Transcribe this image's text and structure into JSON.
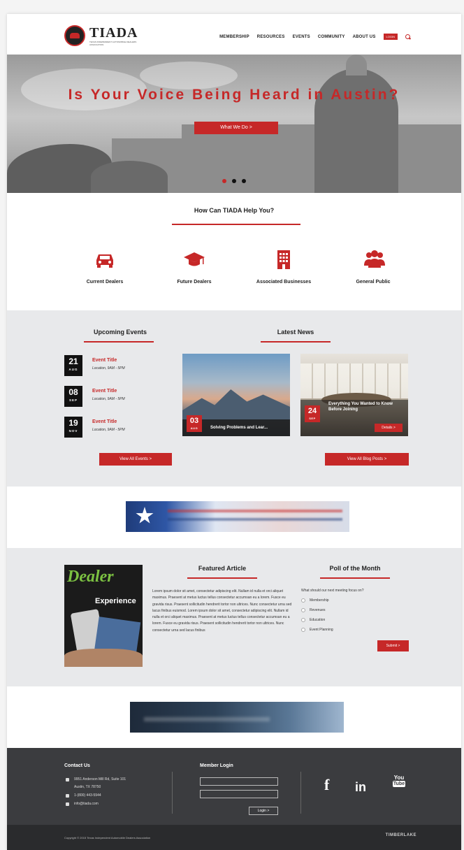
{
  "header": {
    "logo_name": "TIADA",
    "logo_tagline": "Texas Independent Automobile Dealers Association",
    "nav": [
      "MEMBERSHIP",
      "RESOURCES",
      "EVENTS",
      "COMMUNITY",
      "ABOUT US"
    ],
    "login_label": "LOGIN",
    "search_icon": "search-icon"
  },
  "hero": {
    "headline": "Is Your Voice Being Heard in Austin?",
    "cta": "What We Do >",
    "slide_count": 3,
    "active_slide": 1
  },
  "help": {
    "title": "How Can TIADA Help You?",
    "items": [
      {
        "label": "Current Dealers",
        "icon": "car-icon"
      },
      {
        "label": "Future Dealers",
        "icon": "graduation-cap-icon"
      },
      {
        "label": "Associated Businesses",
        "icon": "building-icon"
      },
      {
        "label": "General Public",
        "icon": "people-icon"
      }
    ]
  },
  "events": {
    "title": "Upcoming Events",
    "items": [
      {
        "day": "21",
        "month": "AUG",
        "title": "Event Title",
        "location": "Location, 9AM - 5PM"
      },
      {
        "day": "08",
        "month": "SEP",
        "title": "Event Title",
        "location": "Location, 9AM - 5PM"
      },
      {
        "day": "19",
        "month": "NOV",
        "title": "Event Title",
        "location": "Location, 9AM - 5PM"
      }
    ],
    "view_all": "View All Events >"
  },
  "news": {
    "title": "Latest News",
    "items": [
      {
        "day": "03",
        "month": "AUG",
        "title": "Solving Problems and Lear..."
      },
      {
        "day": "24",
        "month": "SEP",
        "title": "Everything You Wanted to Know Before Joining",
        "details": "Details >"
      }
    ],
    "view_all": "View All Blog Posts >"
  },
  "featured": {
    "title": "Featured Article",
    "magazine_title": "Dealer",
    "magazine_subtitle": "Experience",
    "body": "Lorem ipsum dolor sit amet, consectetur adipiscing elit. Nullam id nulla et orci aliquet maximus. Praesent at metus luctus tellus consectetur accumsan eu a lorem. Fusce eu gravida risus. Praesent sollicitudin hendrerit tortor non ultrices. Nunc consectetur urna sed lacus finibus euismod. Lorem ipsum dolor sit amet, consectetur adipiscing elit. Nullam id nulla et orci aliquet maximus. Praesent at metus luctus tellus consectetur accumsan eu a lorem. Fusce eu gravida risus. Praesent sollicitudin hendrerit tortor non ultrices. Nunc consectetur urna sed lacus finibus"
  },
  "poll": {
    "title": "Poll of the Month",
    "question": "What should our next meeting focus on?",
    "options": [
      "Membership",
      "Revenues",
      "Education",
      "Event Planning"
    ],
    "submit": "Submit >"
  },
  "footer": {
    "contact_title": "Contact Us",
    "address1": "9951 Anderson Mill Rd, Suite 101",
    "address2": "Austin, TX 78750",
    "phone": "1-(800) 443-5944",
    "email": "info@tiada.com",
    "member_login_title": "Member Login",
    "login_button": "Login >",
    "social": {
      "facebook": "f",
      "linkedin": "in",
      "youtube_top": "You",
      "youtube_bottom": "Tube"
    },
    "copyright": "Copyright © 2015 Texas Independent Automobile Dealers Association",
    "credit": "TIMBERLAKE"
  },
  "colors": {
    "accent": "#c62828",
    "footer": "#3b3c3f",
    "section_gray": "#e8e9eb"
  }
}
